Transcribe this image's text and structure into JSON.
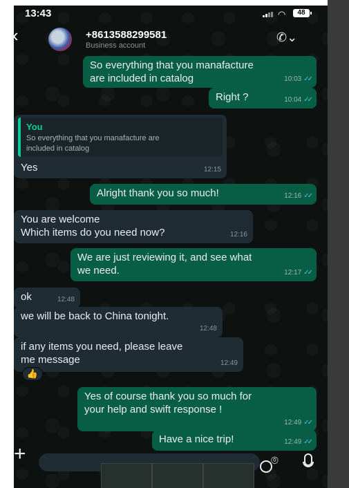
{
  "status_bar": {
    "time": "13:43",
    "battery": "48"
  },
  "header": {
    "contact_name": "+8613588299581",
    "contact_subtitle": "Business account",
    "back_icon": "chevron-left-icon",
    "call_icon": "phone-icon"
  },
  "messages": [
    {
      "dir": "out",
      "text": "So everything that you manafacture\nare included in catalog",
      "time": "10:03",
      "ticks": "✓✓"
    },
    {
      "dir": "out",
      "text": "Right ?",
      "time": "10:04",
      "ticks": "✓✓"
    },
    {
      "dir": "in",
      "quote_author": "You",
      "quote_text": "So everything that you manafacture are\nincluded in catalog",
      "text": "Yes",
      "time": "12:15"
    },
    {
      "dir": "out",
      "text": "Alright thank you so much!",
      "time": "12:16",
      "ticks": "✓✓"
    },
    {
      "dir": "in",
      "text": "You are welcome\nWhich items do you need now?",
      "time": "12:16"
    },
    {
      "dir": "out",
      "text": "We are just reviewing it, and see what\nwe need.",
      "time": "12:17",
      "ticks": "✓✓"
    },
    {
      "dir": "in",
      "text": "ok",
      "time": "12:48"
    },
    {
      "dir": "in",
      "text": "we will be back to China tonight.",
      "time": "12:48"
    },
    {
      "dir": "in",
      "text": "if any items you need, please leave\nme message",
      "time": "12:49",
      "reaction": "👍"
    },
    {
      "dir": "out",
      "text": "Yes of course thank you so much for\nyour help and swift response !",
      "time": "12:49",
      "ticks": "✓✓"
    },
    {
      "dir": "out",
      "text": "Have a nice trip!",
      "time": "12:49",
      "ticks": "✓✓"
    }
  ],
  "input_bar": {
    "plus_icon": "plus-icon",
    "sticker_icon": "sticker-icon",
    "camera_icon": "camera-icon",
    "mic_icon": "microphone-icon"
  }
}
